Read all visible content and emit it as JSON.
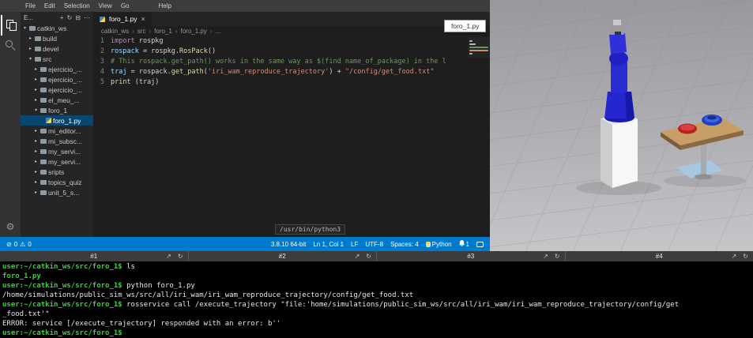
{
  "colors": {
    "status_bar": "#007acc",
    "selection": "#094771",
    "terminal_green": "#33d633",
    "robot_blue": "#2b2bd6",
    "table_wood": "#c79e66"
  },
  "vscode": {
    "menu": [
      "File",
      "Edit",
      "Selection",
      "View",
      "Go",
      "Help"
    ],
    "explorer": {
      "title": "E...",
      "items": [
        {
          "label": "catkin_ws",
          "type": "folder",
          "expanded": true,
          "depth": 0
        },
        {
          "label": "build",
          "type": "folder",
          "depth": 1
        },
        {
          "label": "devel",
          "type": "folder",
          "depth": 1
        },
        {
          "label": "src",
          "type": "folder",
          "expanded": true,
          "depth": 1
        },
        {
          "label": "ejercicio_...",
          "type": "folder",
          "depth": 2
        },
        {
          "label": "ejercicio_...",
          "type": "folder",
          "depth": 2
        },
        {
          "label": "ejercicio_...",
          "type": "folder",
          "depth": 2
        },
        {
          "label": "el_meu_...",
          "type": "folder",
          "depth": 2
        },
        {
          "label": "foro_1",
          "type": "folder",
          "expanded": true,
          "depth": 2
        },
        {
          "label": "foro_1.py",
          "type": "file",
          "selected": true,
          "depth": 3
        },
        {
          "label": "mi_editor...",
          "type": "folder",
          "depth": 2
        },
        {
          "label": "mi_subsc...",
          "type": "folder",
          "depth": 2
        },
        {
          "label": "my_servi...",
          "type": "folder",
          "depth": 2
        },
        {
          "label": "my_servi...",
          "type": "folder",
          "depth": 2
        },
        {
          "label": "sripts",
          "type": "folder",
          "depth": 2
        },
        {
          "label": "topics_quiz",
          "type": "folder",
          "depth": 2
        },
        {
          "label": "unit_5_s...",
          "type": "folder",
          "depth": 2
        }
      ]
    },
    "tab": {
      "label": "foro_1.py",
      "close": "×"
    },
    "breadcrumb": [
      "catkin_ws",
      "src",
      "foro_1",
      "foro_1.py",
      "..."
    ],
    "code": {
      "lines": [
        {
          "num": "1",
          "segments": [
            {
              "t": "import",
              "c": "kw"
            },
            {
              "t": " rospkg",
              "c": "plain"
            }
          ]
        },
        {
          "num": "2",
          "segments": [
            {
              "t": "rospack",
              "c": "var"
            },
            {
              "t": " = rospkg.",
              "c": "plain"
            },
            {
              "t": "RosPack",
              "c": "func"
            },
            {
              "t": "()",
              "c": "plain"
            }
          ]
        },
        {
          "num": "3",
          "segments": [
            {
              "t": "# This rospack.get_path() works in the same way as $(find name_of_package) in the l",
              "c": "comment"
            }
          ]
        },
        {
          "num": "4",
          "segments": [
            {
              "t": "traj",
              "c": "var"
            },
            {
              "t": " = rospack.",
              "c": "plain"
            },
            {
              "t": "get_path",
              "c": "func"
            },
            {
              "t": "(",
              "c": "plain"
            },
            {
              "t": "'iri_wam_reproduce_trajectory'",
              "c": "str"
            },
            {
              "t": ") + ",
              "c": "plain"
            },
            {
              "t": "\"/config/get_food.txt\"",
              "c": "str"
            }
          ]
        },
        {
          "num": "5",
          "segments": [
            {
              "t": "print",
              "c": "func"
            },
            {
              "t": " (traj)",
              "c": "plain"
            }
          ]
        }
      ]
    },
    "interpreter_tooltip": "/usr/bin/python3",
    "status": {
      "errors": "0",
      "warnings": "0",
      "items": [
        "3.8.10 64-bit",
        "Ln 1, Col 1",
        "LF",
        "UTF-8",
        "Spaces: 4"
      ],
      "python_label": "Python",
      "bell_count": "1"
    }
  },
  "file_tooltip": "foro_1.py",
  "terminal": {
    "tabs": [
      {
        "label": "#1"
      },
      {
        "label": "#2"
      },
      {
        "label": "#3"
      },
      {
        "label": "#4"
      }
    ],
    "lines": [
      {
        "prompt": "user:~/catkin_ws/src/foro_1$",
        "text": " ls"
      },
      {
        "text": "foro_1.py",
        "color": "green"
      },
      {
        "prompt": "user:~/catkin_ws/src/foro_1$",
        "text": " python foro_1.py"
      },
      {
        "text": "/home/simulations/public_sim_ws/src/all/iri_wam/iri_wam_reproduce_trajectory/config/get_food.txt"
      },
      {
        "prompt": "user:~/catkin_ws/src/foro_1$",
        "text": " rosservice call /execute_trajectory \"file:'home/simulations/public_sim_ws/src/all/iri_wam/iri_wam_reproduce_trajectory/config/get"
      },
      {
        "text": "_food.txt'\""
      },
      {
        "text": "ERROR: service [/execute_trajectory] responded with an error: b''"
      },
      {
        "prompt": "user:~/catkin_ws/src/foro_1$",
        "text": ""
      }
    ]
  },
  "icons": {
    "expand": "↗",
    "reload": "↻",
    "error": "⊘",
    "warning": "⚠",
    "gear": "⚙",
    "more": "⋯",
    "refresh": "↻",
    "collapse": "⊟",
    "new_file": "+"
  }
}
